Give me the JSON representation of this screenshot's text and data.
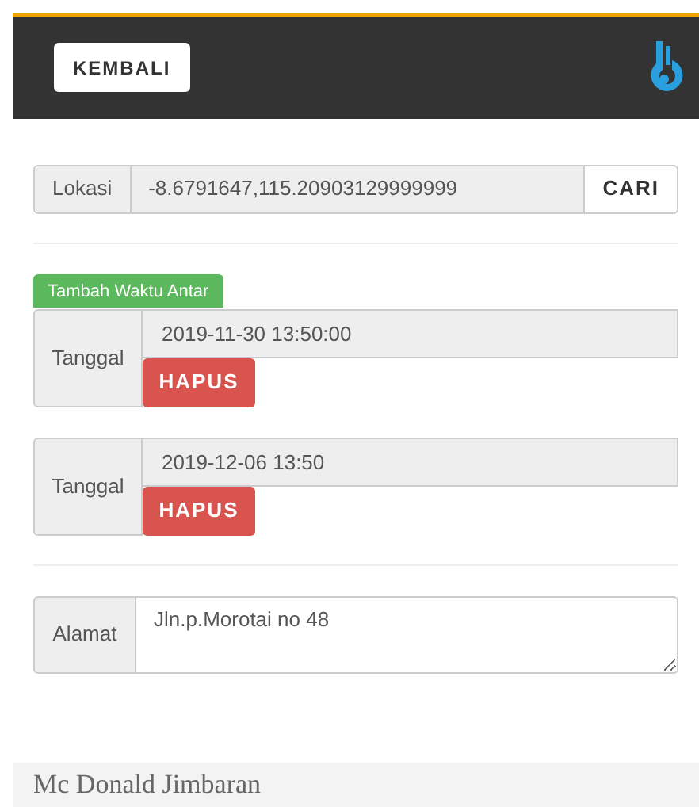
{
  "header": {
    "back_button": "KEMBALI"
  },
  "location": {
    "label": "Lokasi",
    "value": "-8.6791647,115.20903129999999",
    "button": "CARI"
  },
  "add_time_button": "Tambah Waktu Antar",
  "delivery_times": [
    {
      "label": "Tanggal",
      "value": "2019-11-30 13:50:00",
      "delete_button": "HAPUS"
    },
    {
      "label": "Tanggal",
      "value": "2019-12-06 13:50",
      "delete_button": "HAPUS"
    }
  ],
  "address": {
    "label": "Alamat",
    "value": "Jln.p.Morotai no 48"
  },
  "store": {
    "title": "Mc Donald Jimbaran"
  }
}
